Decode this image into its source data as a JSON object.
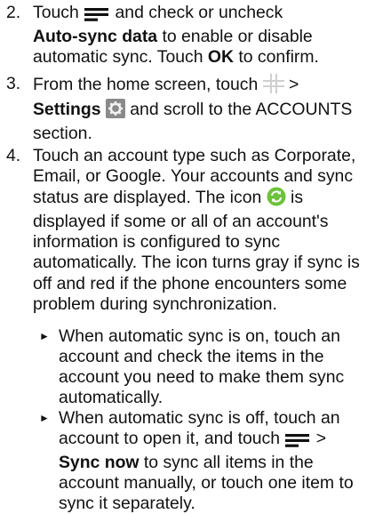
{
  "steps": [
    {
      "number": "2.",
      "before_icon": "Touch ",
      "icon": "menu-icon",
      "after_icon": " and check or uncheck",
      "bold1": "Auto-sync data",
      "mid": " to enable or disable automatic sync. Touch ",
      "bold2": "OK",
      "end": " to confirm."
    },
    {
      "number": "3.",
      "before_icon": "From the home screen, touch ",
      "icon": "app-grid-icon",
      "after_icon": " >",
      "bold1": "Settings",
      "icon2": "settings-icon",
      "end": " and scroll to the ACCOUNTS section."
    },
    {
      "number": "4.",
      "line1": "Touch an account type such as Corporate, Email, or Google. Your accounts and sync status are displayed. The icon ",
      "icon": "sync-green-icon",
      "line2": " is displayed if some or all of an account's information is configured to sync automatically. The icon turns gray if sync is off and red if the phone encounters some problem during synchronization."
    }
  ],
  "bullets": [
    {
      "text": "When automatic sync is on, touch an account and check the items in the account you need to make them sync automatically."
    },
    {
      "before": "When automatic sync is off, touch an account to open it, and touch ",
      "icon": "menu-icon",
      "after": " >",
      "bold": "Sync now",
      "end": " to sync all items in the account manually, or touch one item to sync it separately."
    }
  ],
  "colors": {
    "text": "#111111",
    "sync_green": "#6cc23a",
    "settings_bg": "#8a8a8a"
  }
}
